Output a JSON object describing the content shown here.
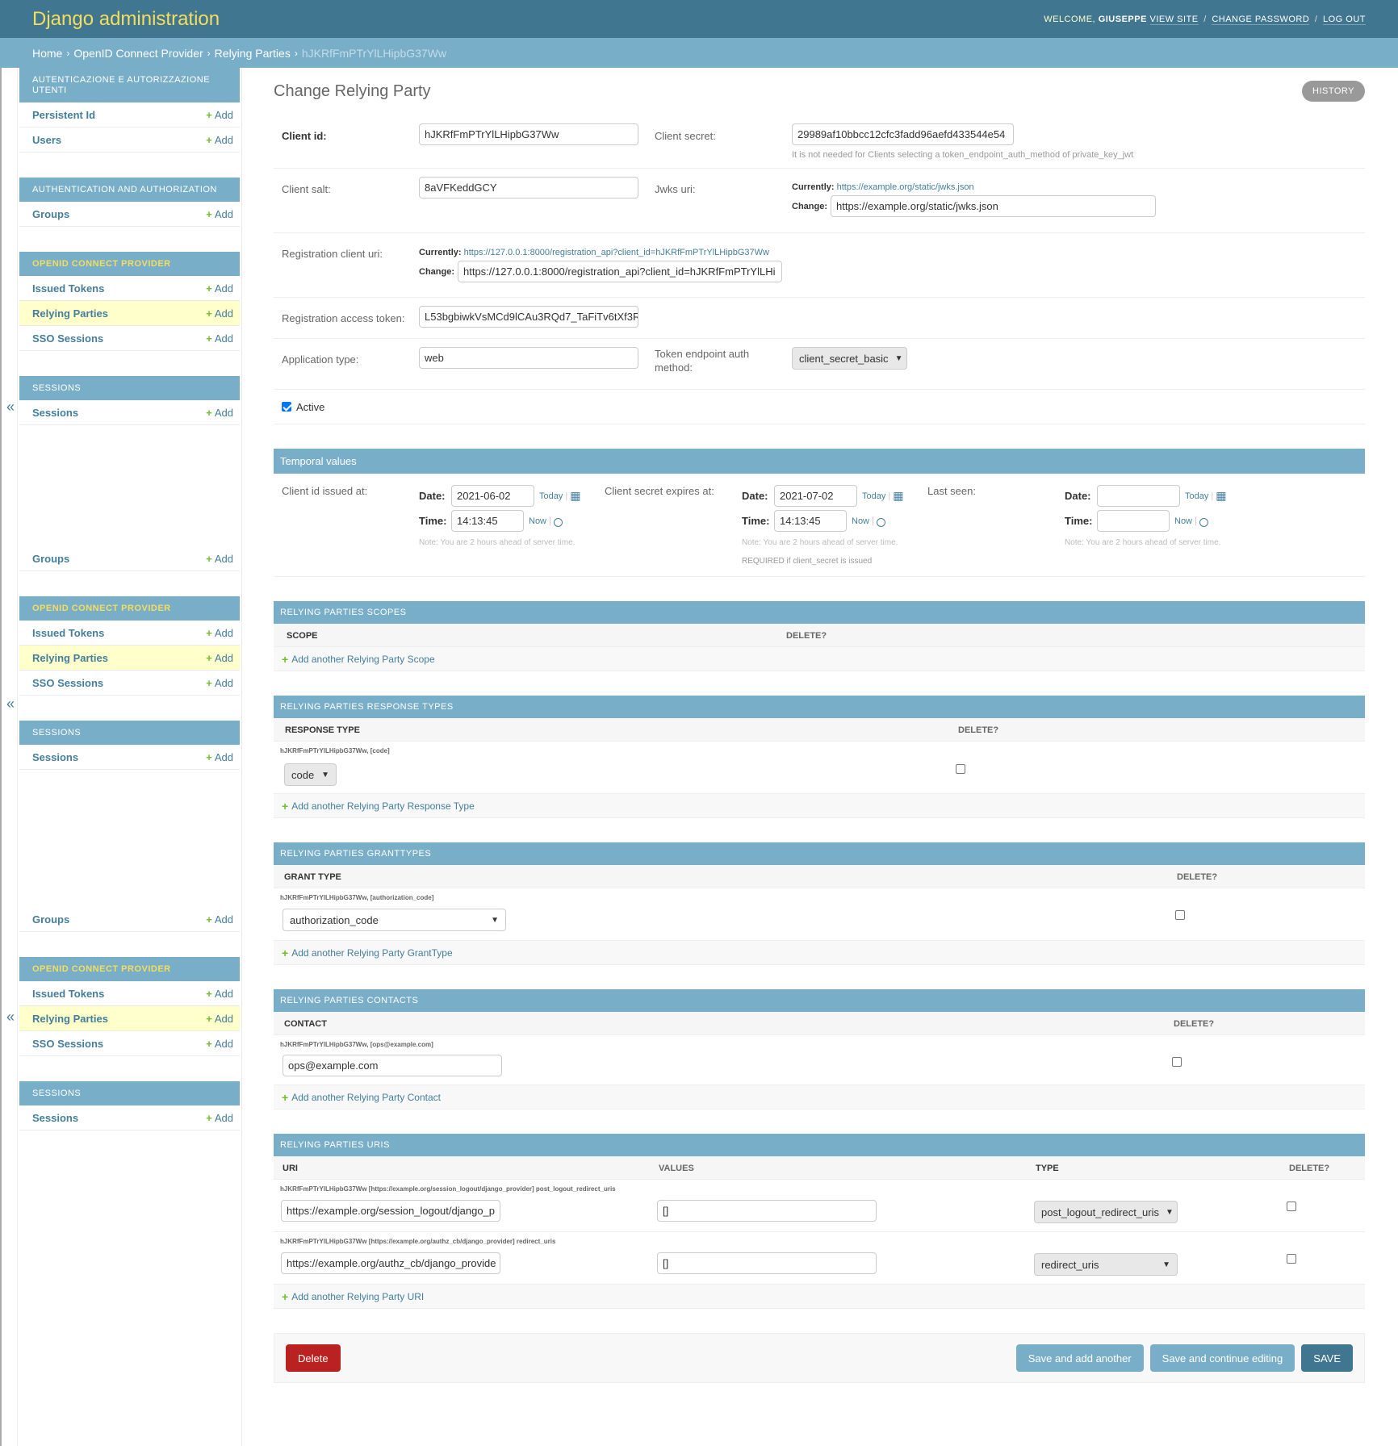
{
  "header": {
    "branding": "Django administration",
    "welcome": "WELCOME,",
    "user": "GIUSEPPE",
    "view_site": "VIEW SITE",
    "change_password": "CHANGE PASSWORD",
    "logout": "LOG OUT",
    "separator": "/"
  },
  "breadcrumbs": {
    "home": "Home",
    "app": "OpenID Connect Provider",
    "model": "Relying Parties",
    "current": "hJKRfFmPTrYlLHipbG37Ww",
    "separator": "›"
  },
  "sidebar": {
    "toggle": "«",
    "add_label": "Add",
    "plus": "+",
    "modules": {
      "auth_users": {
        "caption": "AUTENTICAZIONE E AUTORIZZAZIONE UTENTI",
        "items": [
          "Persistent Id",
          "Users"
        ]
      },
      "auth": {
        "caption": "AUTHENTICATION AND AUTHORIZATION",
        "items": [
          "Groups"
        ]
      },
      "oidc": {
        "caption": "OPENID CONNECT PROVIDER",
        "items": [
          "Issued Tokens",
          "Relying Parties",
          "SSO Sessions"
        ]
      },
      "sessions": {
        "caption": "SESSIONS",
        "items": [
          "Sessions"
        ]
      }
    }
  },
  "page": {
    "title": "Change Relying Party",
    "history": "HISTORY"
  },
  "fields": {
    "client_id": {
      "label": "Client id:",
      "value": "hJKRfFmPTrYlLHipbG37Ww"
    },
    "client_secret": {
      "label": "Client secret:",
      "value": "29989af10bbcc12cfc3fadd96aefd433544e54",
      "help": "It is not needed for Clients selecting a token_endpoint_auth_method of private_key_jwt"
    },
    "client_salt": {
      "label": "Client salt:",
      "value": "8aVFKeddGCY"
    },
    "jwks_uri": {
      "label": "Jwks uri:",
      "currently_label": "Currently:",
      "currently": "https://example.org/static/jwks.json",
      "change_label": "Change:",
      "value": "https://example.org/static/jwks.json"
    },
    "registration_client_uri": {
      "label": "Registration client uri:",
      "currently_label": "Currently:",
      "currently": "https://127.0.0.1:8000/registration_api?client_id=hJKRfFmPTrYlLHipbG37Ww",
      "change_label": "Change:",
      "value": "https://127.0.0.1:8000/registration_api?client_id=hJKRfFmPTrYlLHi"
    },
    "registration_access_token": {
      "label": "Registration access token:",
      "value": "L53bgbiwkVsMCd9lCAu3RQd7_TaFiTv6tXf3R"
    },
    "application_type": {
      "label": "Application type:",
      "value": "web"
    },
    "token_endpoint_auth_method": {
      "label_line1": "Token endpoint auth",
      "label_line2": "method:",
      "value": "client_secret_basic"
    },
    "active": {
      "label": "Active",
      "checked": true
    }
  },
  "temporal": {
    "heading": "Temporal values",
    "date_label": "Date:",
    "time_label": "Time:",
    "today": "Today",
    "now": "Now",
    "note": "Note: You are 2 hours ahead of server time.",
    "client_id_issued_at": {
      "label": "Client id issued at:",
      "date": "2021-06-02",
      "time": "14:13:45"
    },
    "client_secret_expires_at": {
      "label": "Client secret expires at:",
      "date": "2021-07-02",
      "time": "14:13:45",
      "help": "REQUIRED if client_secret is issued"
    },
    "last_seen": {
      "label": "Last seen:",
      "date": "",
      "time": ""
    }
  },
  "inlines": {
    "delete_header": "DELETE?",
    "scopes": {
      "heading": "RELYING PARTIES SCOPES",
      "col_scope": "SCOPE",
      "add": "Add another Relying Party Scope"
    },
    "response_types": {
      "heading": "RELYING PARTIES RESPONSE TYPES",
      "col": "RESPONSE TYPE",
      "row_original": "hJKRfFmPTrYlLHipbG37Ww, [code]",
      "row_value": "code",
      "add": "Add another Relying Party Response Type"
    },
    "grant_types": {
      "heading": "RELYING PARTIES GRANTTYPES",
      "col": "GRANT TYPE",
      "row_original": "hJKRfFmPTrYlLHipbG37Ww, [authorization_code]",
      "row_value": "authorization_code",
      "add": "Add another Relying Party GrantType"
    },
    "contacts": {
      "heading": "RELYING PARTIES CONTACTS",
      "col": "CONTACT",
      "row_original": "hJKRfFmPTrYlLHipbG37Ww, [ops@example.com]",
      "row_value": "ops@example.com",
      "add": "Add another Relying Party Contact"
    },
    "uris": {
      "heading": "RELYING PARTIES URIS",
      "col_uri": "URI",
      "col_values": "VALUES",
      "col_type": "TYPE",
      "rows": [
        {
          "original": "hJKRfFmPTrYlLHipbG37Ww [https://example.org/session_logout/django_provider] post_logout_redirect_uris",
          "uri": "https://example.org/session_logout/django_p",
          "values": "[]",
          "type": "post_logout_redirect_uris"
        },
        {
          "original": "hJKRfFmPTrYlLHipbG37Ww [https://example.org/authz_cb/django_provider] redirect_uris",
          "uri": "https://example.org/authz_cb/django_provide",
          "values": "[]",
          "type": "redirect_uris"
        }
      ],
      "add": "Add another Relying Party URI"
    }
  },
  "submit": {
    "delete": "Delete",
    "save_add": "Save and add another",
    "save_continue": "Save and continue editing",
    "save": "SAVE"
  },
  "icons": {
    "calendar": "calendar-icon",
    "clock": "clock-icon",
    "chevron": "chevron-down-icon",
    "plus": "plus-icon"
  },
  "colors": {
    "header_bg": "#417690",
    "branding": "#f5dd5d",
    "breadcrumbs_bg": "#79aec8",
    "module_caption_bg": "#79aec8",
    "link": "#447e9b",
    "add_plus": "#70bf2b",
    "selected_row": "#ffffcc",
    "delete_button": "#ba2121"
  }
}
